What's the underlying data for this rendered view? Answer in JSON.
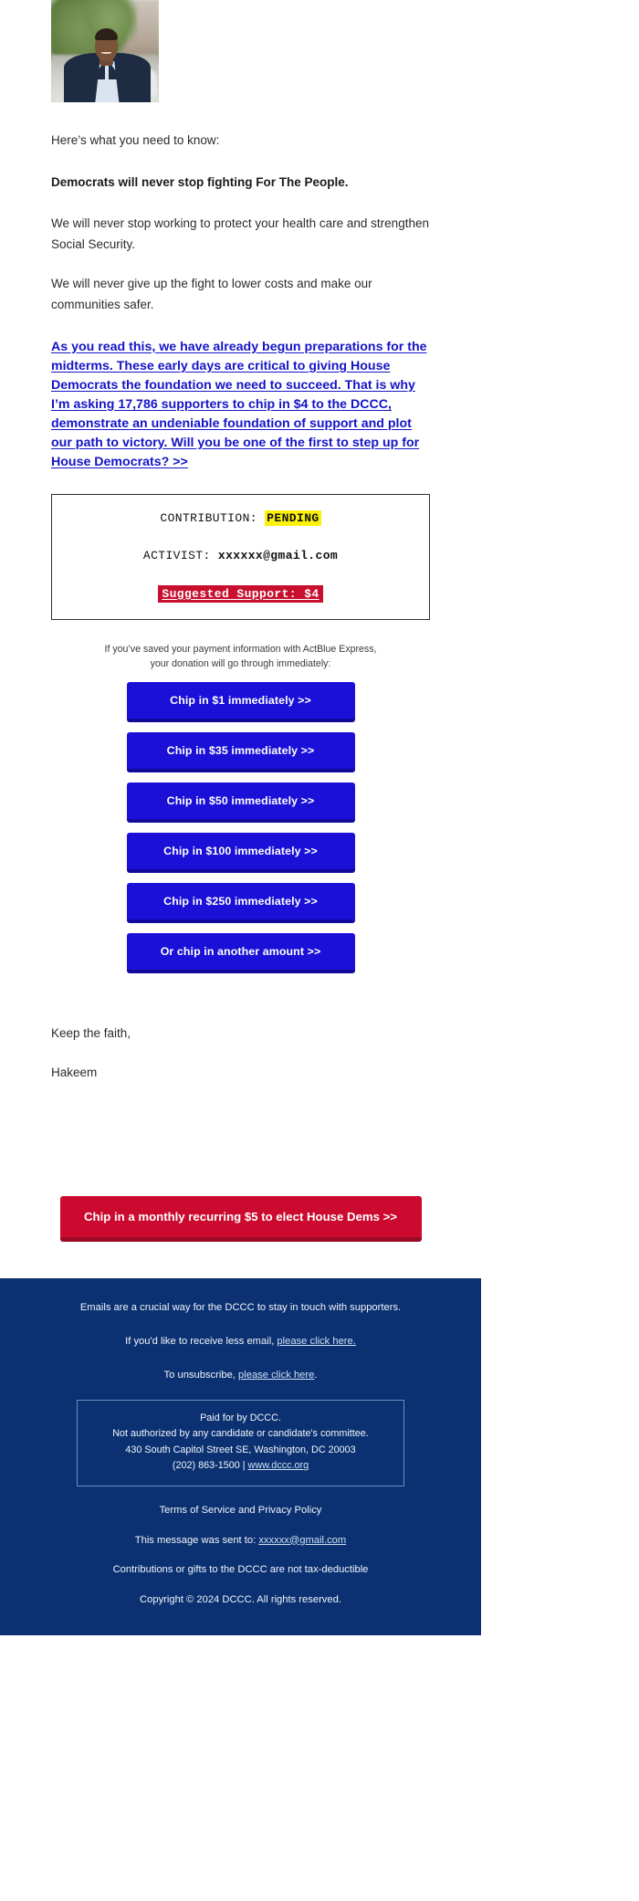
{
  "hero": {
    "photo_alt": "Hakeem Jeffries portrait"
  },
  "body": {
    "intro": "Here’s what you need to know:",
    "bold_line": "Democrats will never stop fighting For The People.",
    "para_1": "We will never stop working to protect your health care and strengthen Social Security.",
    "para_2": "We will never give up the fight to lower costs and make our communities safer.",
    "ask_link": "As you read this, we have already begun preparations for the midterms. These early days are critical to giving House Democrats the foundation we need to succeed. That is why I’m asking 17,786 supporters to chip in $4 to the DCCC, demonstrate an undeniable foundation of support and plot our path to victory. Will you be one of the first to step up for House Democrats? >>",
    "supporters_count": "17,786",
    "ask_amount": "$4"
  },
  "contribution_box": {
    "contribution_label": "CONTRIBUTION:",
    "contribution_status": "PENDING",
    "activist_label": "ACTIVIST:",
    "activist_email": "xxxxxx@gmail.com",
    "suggested_support": "Suggested Support: $4",
    "highlight_color": "#fbf10a",
    "suggested_bg_color": "#c8102e"
  },
  "actblue": {
    "note_line_1": "If you’ve saved your payment information with ActBlue Express,",
    "note_line_2": "your donation will go through immediately:"
  },
  "donation_buttons": [
    {
      "label": "Chip in $1 immediately >>"
    },
    {
      "label": "Chip in $35 immediately >>"
    },
    {
      "label": "Chip in $50 immediately >>"
    },
    {
      "label": "Chip in $100 immediately >>"
    },
    {
      "label": "Chip in $250 immediately >>"
    },
    {
      "label": "Or chip in another amount >>"
    }
  ],
  "signoff": {
    "closing": "Keep the faith,",
    "name": "Hakeem"
  },
  "recurring": {
    "label": "Chip in a monthly recurring $5 to elect House Dems >>",
    "color": "#cc0a2f"
  },
  "footer": {
    "bg_color": "#0b3172",
    "line_1": "Emails are a crucial way for the DCCC to stay in touch with supporters.",
    "less_email_prefix": "If you'd like to receive less email, ",
    "less_email_link": "please click here.",
    "unsubscribe_prefix": "To unsubscribe, ",
    "unsubscribe_link": "please click here",
    "unsubscribe_suffix": ".",
    "paid_for": "Paid for by DCCC.",
    "not_authorized": "Not authorized by any candidate or candidate's committee.",
    "address": "430 South Capitol Street SE, Washington, DC 20003",
    "phone": "(202) 863-1500 |",
    "website": "www.dccc.org",
    "terms": "Terms of Service and Privacy Policy",
    "sent_to_prefix": "This message was sent to: ",
    "sent_to_email": "xxxxxx@gmail.com",
    "tax": "Contributions or gifts to the DCCC are not tax-deductible",
    "copyright": "Copyright © 2024 DCCC. All rights reserved."
  }
}
